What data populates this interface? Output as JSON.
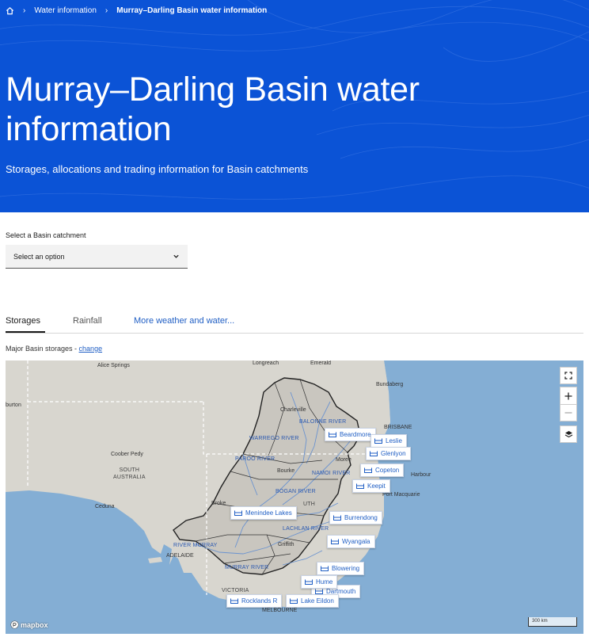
{
  "breadcrumb": {
    "home_icon": "home-icon",
    "items": [
      "Water information",
      "Murray–Darling Basin water information"
    ]
  },
  "hero": {
    "title": "Murray–Darling Basin water information",
    "subtitle": "Storages, allocations and trading information for Basin catchments",
    "background_color": "#0b53d6"
  },
  "catchment_select": {
    "label": "Select a Basin catchment",
    "value": "Select an option"
  },
  "tabs": {
    "storages": "Storages",
    "rainfall": "Rainfall",
    "more": "More weather and water..."
  },
  "storages_line": {
    "text": "Major Basin storages - ",
    "link": "change"
  },
  "map": {
    "towns": {
      "longreach": "Longreach",
      "emerald": "Emerald",
      "alice_springs": "Alice Springs",
      "bundaberg": "Bundaberg",
      "burton": "burton",
      "charleville": "Charleville",
      "brisbane": "BRISBANE",
      "coober_pedy": "Coober Pedy",
      "moree": "Moree",
      "bourke": "Bourke",
      "harbour": "Harbour",
      "port_macquarie": "Port Macquarie",
      "ceduna": "Ceduna",
      "broken_hill": "Broke",
      "griffith": "Griffith",
      "adelaide": "ADELAIDE",
      "melbourne": "MELBOURNE"
    },
    "regions": {
      "sa": "SOUTH\nAUSTRALIA",
      "balonne": "BALONNE RIVER",
      "warrego": "WARREGO RIVER",
      "paroo": "PAROO RIVER",
      "namoi": "NAMOI RIVER",
      "gwydir": "GWYDIR",
      "bogan": "BOGAN RIVER",
      "lachlan": "LACHLAN RIVER",
      "river_murray": "RIVER MURRAY",
      "murray": "MURRAY RIVER",
      "victoria": "VICTORIA",
      "nsw": "UTH"
    },
    "storages": [
      "Beardmore",
      "Leslie",
      "Glenlyon",
      "Copeton",
      "Keepit",
      "Menindee Lakes",
      "Burrendong",
      "Wyangala",
      "Blowering",
      "Hume",
      "Dartmouth",
      "Rocklands R",
      "Lake Eildon"
    ],
    "controls": [
      "fullscreen-icon",
      "zoom-in-icon",
      "zoom-out-icon",
      "layers-icon"
    ],
    "attribution": "mapbox",
    "scale_label": "300 km",
    "colors": {
      "land": "#d8d6cf",
      "sea": "#84aed4",
      "basin_fill": "#c9c6bf"
    }
  }
}
